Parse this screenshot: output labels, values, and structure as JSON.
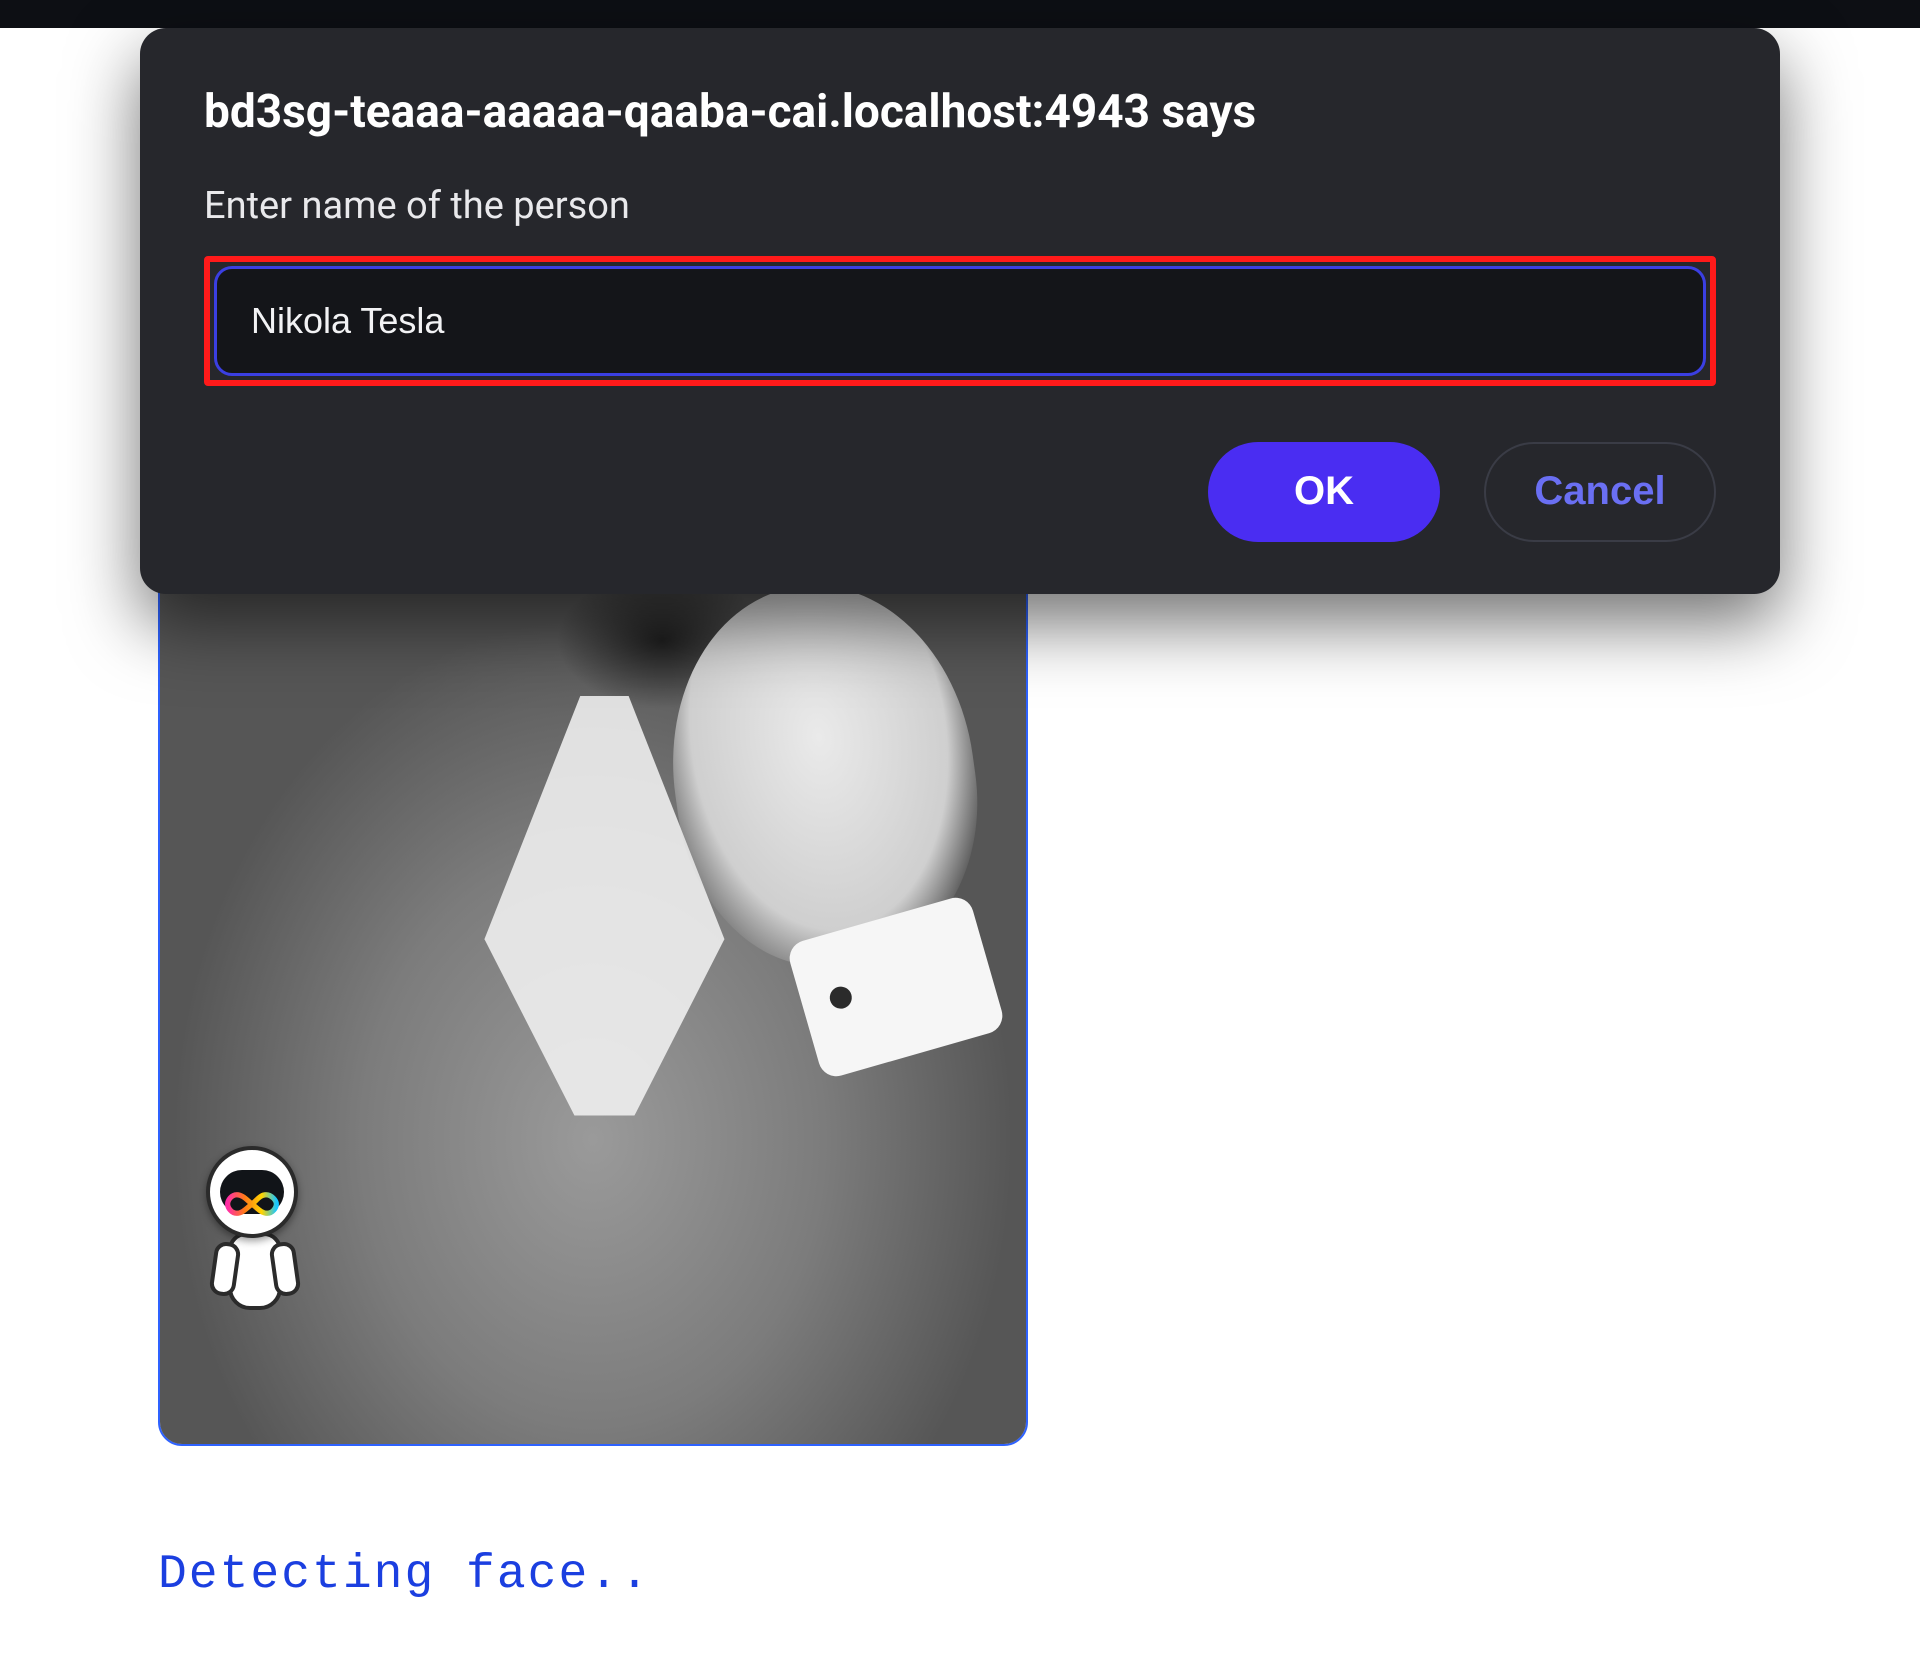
{
  "dialog": {
    "origin_line": "bd3sg-teaaa-aaaaa-qaaba-cai.localhost:4943 says",
    "prompt_label": "Enter name of the person",
    "input_value": "Nikola Tesla",
    "ok_label": "OK",
    "cancel_label": "Cancel"
  },
  "page": {
    "status_text": "Detecting face..",
    "badge_icon": "infinity-icon"
  },
  "colors": {
    "accent": "#4a2df2",
    "input_border": "#3b3fe2",
    "highlight": "#ff1a1a",
    "link": "#1b3fe0"
  }
}
